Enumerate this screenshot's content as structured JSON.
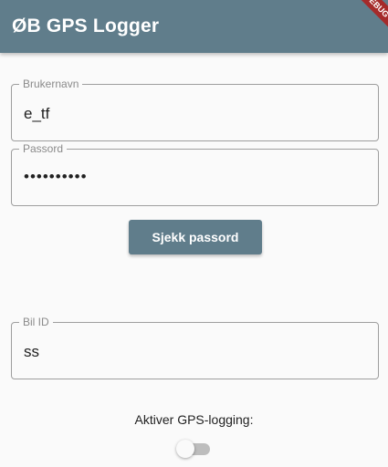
{
  "appbar": {
    "title": "ØB GPS Logger",
    "background_color": "#607d8b",
    "debug_banner": "DEBUG"
  },
  "form": {
    "username": {
      "label": "Brukernavn",
      "value": "e_tf"
    },
    "password": {
      "label": "Passord",
      "value": "••••••••••"
    },
    "check_button_label": "Sjekk passord",
    "car_id": {
      "label": "Bil ID",
      "value": "ss"
    }
  },
  "gps_logging": {
    "label": "Aktiver GPS-logging:",
    "enabled": false
  }
}
